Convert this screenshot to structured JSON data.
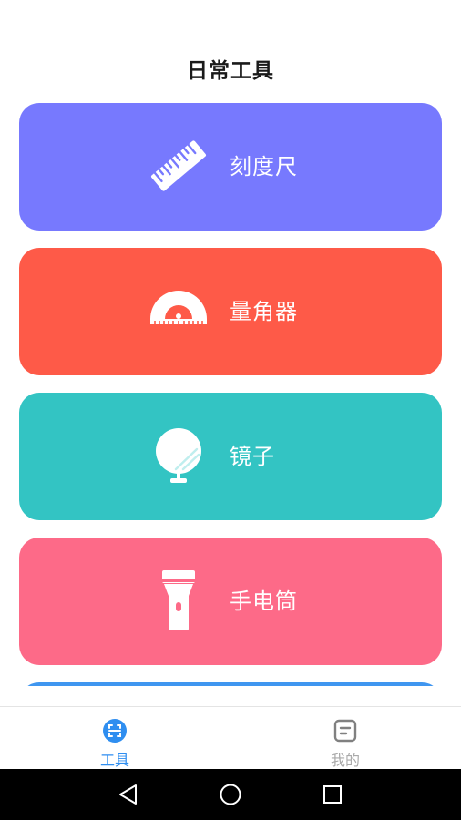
{
  "header": {
    "title": "日常工具"
  },
  "tools": [
    {
      "label": "刻度尺",
      "icon": "ruler-icon",
      "color": "#7779fe"
    },
    {
      "label": "量角器",
      "icon": "protractor-icon",
      "color": "#fe5a48"
    },
    {
      "label": "镜子",
      "icon": "mirror-icon",
      "color": "#33c4c3"
    },
    {
      "label": "手电筒",
      "icon": "flashlight-icon",
      "color": "#fd6a88"
    }
  ],
  "partial_card_color": "#3f96f0",
  "tabbar": {
    "tabs": [
      {
        "label": "工具",
        "icon": "scan-icon",
        "active": true
      },
      {
        "label": "我的",
        "icon": "profile-doc-icon",
        "active": false
      }
    ],
    "active_color": "#2f8ef0",
    "inactive_color": "#a9a9a9"
  },
  "system_nav": {
    "buttons": [
      "back-icon",
      "home-icon",
      "recent-apps-icon"
    ]
  }
}
